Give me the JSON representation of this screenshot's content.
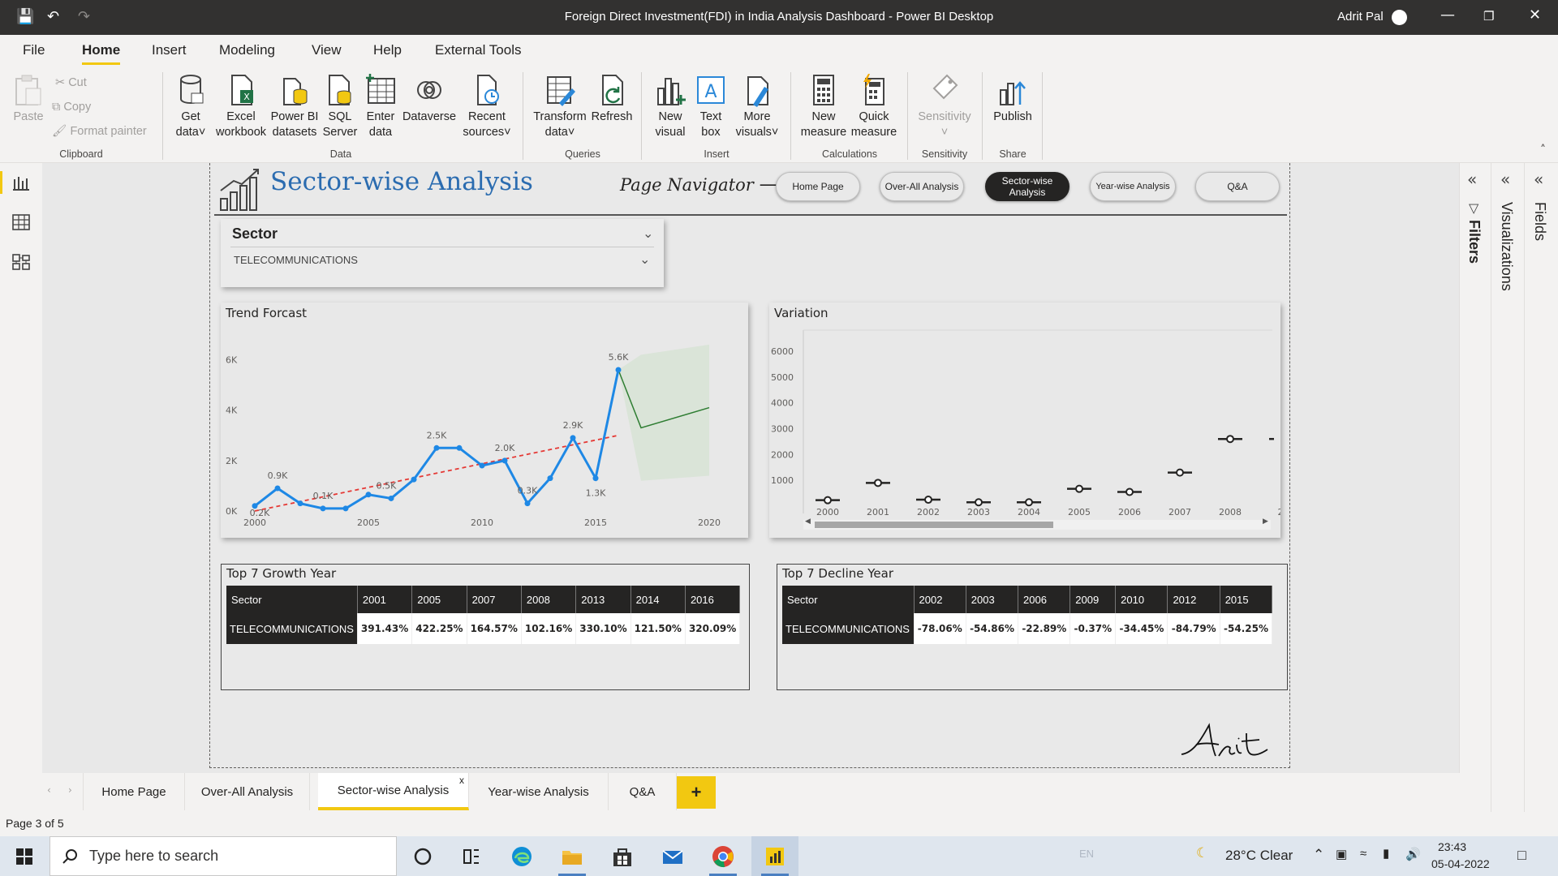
{
  "window": {
    "title": "Foreign Direct Investment(FDI) in India Analysis Dashboard - Power BI Desktop",
    "user": "Adrit Pal"
  },
  "menu": [
    "File",
    "Home",
    "Insert",
    "Modeling",
    "View",
    "Help",
    "External Tools"
  ],
  "ribbon": {
    "clipboard": {
      "paste": "Paste",
      "cut": "Cut",
      "copy": "Copy",
      "format_painter": "Format painter",
      "group": "Clipboard"
    },
    "data": {
      "get_data": [
        "Get",
        "data"
      ],
      "excel": [
        "Excel",
        "workbook"
      ],
      "pbi_datasets": [
        "Power BI",
        "datasets"
      ],
      "sql": [
        "SQL",
        "Server"
      ],
      "enter": [
        "Enter",
        "data"
      ],
      "dataverse": "Dataverse",
      "recent": [
        "Recent",
        "sources"
      ],
      "group": "Data"
    },
    "queries": {
      "transform": [
        "Transform",
        "data"
      ],
      "refresh": "Refresh",
      "group": "Queries"
    },
    "insert": {
      "new_visual": [
        "New",
        "visual"
      ],
      "text_box": [
        "Text",
        "box"
      ],
      "more_visuals": [
        "More",
        "visuals"
      ],
      "group": "Insert"
    },
    "calculations": {
      "new_measure": [
        "New",
        "measure"
      ],
      "quick_measure": [
        "Quick",
        "measure"
      ],
      "group": "Calculations"
    },
    "sensitivity": {
      "label": "Sensitivity",
      "group": "Sensitivity"
    },
    "share": {
      "publish": "Publish",
      "group": "Share"
    }
  },
  "report": {
    "title": "Sector-wise Analysis",
    "navigator_label": "Page Navigator ⟶",
    "nav_buttons": [
      "Home Page",
      "Over-All Analysis",
      "Sector-wise Analysis",
      "Year-wise Analysis",
      "Q&A"
    ],
    "slicer": {
      "label": "Sector",
      "value": "TELECOMMUNICATIONS"
    },
    "signature": "Adrit"
  },
  "trend": {
    "title": "Trend Forcast",
    "y_ticks": [
      "6K",
      "4K",
      "2K",
      "0K"
    ],
    "x_ticks": [
      "2000",
      "2005",
      "2010",
      "2015",
      "2020"
    ],
    "data_labels": [
      "0.2K",
      "0.9K",
      "0.1K",
      "0.5K",
      "2.5K",
      "2.0K",
      "0.3K",
      "2.9K",
      "5.6K",
      "1.3K"
    ],
    "colors": {
      "line": "#1e88e5",
      "trend": "#e53935",
      "forecast": "#2e7d32",
      "band": "#d7e3d5"
    }
  },
  "variation": {
    "title": "Variation",
    "y_ticks": [
      "6000",
      "5000",
      "4000",
      "3000",
      "2000",
      "1000"
    ],
    "x_ticks": [
      "2000",
      "2001",
      "2002",
      "2003",
      "2004",
      "2005",
      "2006",
      "2007",
      "2008",
      "2"
    ]
  },
  "chart_data": [
    {
      "type": "line",
      "title": "Trend Forcast",
      "x": [
        2000,
        2001,
        2002,
        2003,
        2004,
        2005,
        2006,
        2007,
        2008,
        2009,
        2010,
        2011,
        2012,
        2013,
        2014,
        2015,
        2016
      ],
      "series": [
        {
          "values": [
            0.2,
            0.9,
            0.3,
            0.1,
            0.1,
            0.65,
            0.5,
            1.25,
            2.5,
            2.5,
            1.8,
            2.0,
            0.3,
            1.3,
            2.9,
            1.3,
            5.6
          ]
        }
      ],
      "trendline": {
        "x": [
          2000,
          2016
        ],
        "y": [
          0.0,
          3.0
        ]
      },
      "forecast": {
        "x": [
          2016,
          2017,
          2020
        ],
        "y": [
          5.6,
          3.3,
          4.1
        ],
        "upper": [
          5.6,
          6.2,
          6.6
        ],
        "lower": [
          5.6,
          1.2,
          1.4
        ]
      },
      "xlim": [
        2000,
        2020
      ],
      "ylim": [
        0,
        6.5
      ],
      "ylabel": "",
      "xlabel": ""
    },
    {
      "type": "scatter",
      "title": "Variation",
      "categories": [
        "2000",
        "2001",
        "2002",
        "2003",
        "2004",
        "2005",
        "2006",
        "2007",
        "2008"
      ],
      "values": [
        230,
        900,
        250,
        150,
        150,
        670,
        550,
        1300,
        2600
      ],
      "ylim": [
        0,
        6500
      ]
    }
  ],
  "growth": {
    "title": "Top 7 Growth Year",
    "headers": [
      "Sector",
      "2001",
      "2005",
      "2007",
      "2008",
      "2013",
      "2014",
      "2016"
    ],
    "row": [
      "TELECOMMUNICATIONS",
      "391.43%",
      "422.25%",
      "164.57%",
      "102.16%",
      "330.10%",
      "121.50%",
      "320.09%"
    ]
  },
  "decline": {
    "title": "Top 7 Decline Year",
    "headers": [
      "Sector",
      "2002",
      "2003",
      "2006",
      "2009",
      "2010",
      "2012",
      "2015"
    ],
    "row": [
      "TELECOMMUNICATIONS",
      "-78.06%",
      "-54.86%",
      "-22.89%",
      "-0.37%",
      "-34.45%",
      "-84.79%",
      "-54.25%"
    ]
  },
  "panes": {
    "filters": "Filters",
    "visualizations": "Visualizations",
    "fields": "Fields"
  },
  "page_tabs": [
    "Home Page",
    "Over-All Analysis",
    "Sector-wise Analysis",
    "Year-wise Analysis",
    "Q&A"
  ],
  "add_tab": "+",
  "status": "Page 3 of 5",
  "taskbar": {
    "search_placeholder": "Type here to search",
    "lang": "EN",
    "weather": "28°C  Clear",
    "time": "23:43",
    "date": "05-04-2022"
  }
}
